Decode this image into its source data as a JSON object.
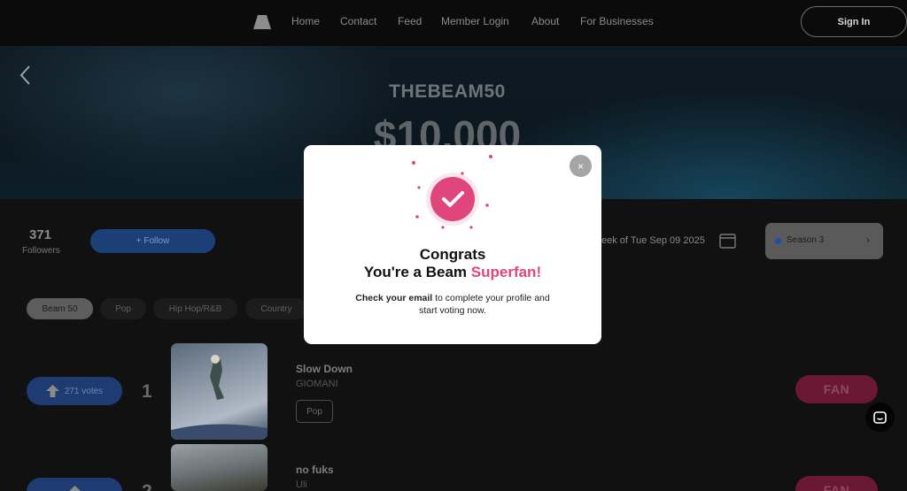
{
  "nav": {
    "links": [
      "Home",
      "Contact",
      "Feed",
      "Member Login",
      "About",
      "For Businesses"
    ],
    "signin_label": "Sign In"
  },
  "hero": {
    "brand": "THEBEAM50",
    "prize": "$10,000"
  },
  "profile": {
    "followers_count": "371",
    "followers_label": "Followers",
    "follow_label": "+ Follow"
  },
  "week": {
    "label": "eek of Tue Sep 09 2025"
  },
  "season": {
    "label": "Season 3",
    "dot_color": "#1e4fa8"
  },
  "genres": [
    {
      "label": "Beam 50",
      "active": true
    },
    {
      "label": "Pop",
      "active": false
    },
    {
      "label": "Hip Hop/R&B",
      "active": false
    },
    {
      "label": "Country",
      "active": false
    }
  ],
  "songs": [
    {
      "rank": "1",
      "votes": "271 votes",
      "title": "Slow Down",
      "artist": "GIOMANI",
      "tag": "Pop",
      "fan_label": "FAN"
    },
    {
      "rank": "2",
      "votes": "",
      "title": "no fuks",
      "artist": "Uli",
      "tag": "",
      "fan_label": "FAN"
    }
  ],
  "modal": {
    "title_line1": "Congrats",
    "title_line2_prefix": "You're a Beam ",
    "title_line2_accent": "Superfan!",
    "body_bold": "Check your email",
    "body_rest_1": " to complete your profile and",
    "body_rest_2": "start voting now.",
    "close_symbol": "×"
  },
  "colors": {
    "accent_pink": "#e0457b",
    "follow_blue": "#1d3f78",
    "fan_red": "#6a1834"
  }
}
